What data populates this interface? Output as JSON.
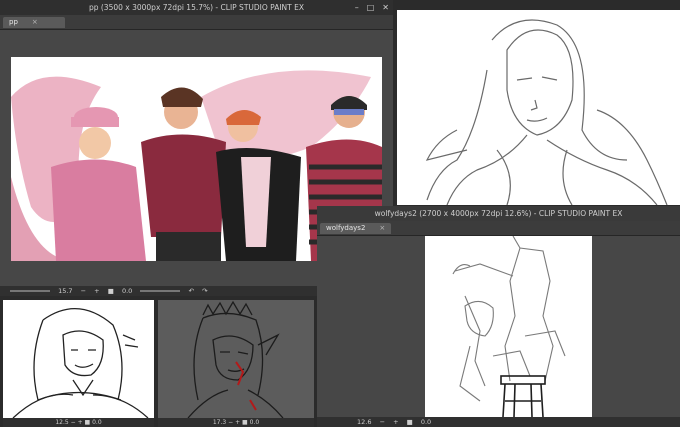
{
  "main_window": {
    "title": "pp (3500 x 3000px 72dpi 15.7%) - CLIP STUDIO PAINT EX",
    "tab_label": "pp",
    "tab_close": "×",
    "controls": {
      "minimize": "–",
      "maximize": "□",
      "close": "✕"
    },
    "status": {
      "zoom": "15.7",
      "angle": "0.0"
    }
  },
  "wolfy_window": {
    "title": "wolfydays2 (2700 x 4000px 72dpi 12.6%) - CLIP STUDIO PAINT EX",
    "tab_label": "wolfydays2",
    "tab_close": "×",
    "status": {
      "zoom": "12.6",
      "angle": "0.0"
    }
  },
  "small_window_1": {
    "status": {
      "zoom": "12.5",
      "angle": "0.0"
    }
  },
  "small_window_2": {
    "status": {
      "zoom": "17.3",
      "angle": "0.0"
    }
  },
  "status_icons": {
    "minus": "−",
    "plus": "+",
    "fit": "■",
    "rotate_left": "↶",
    "rotate_right": "↷"
  },
  "colors": {
    "app_bg": "#2b2b2b",
    "panel_bg": "#474747",
    "pink_wing": "#e8a5b8",
    "maroon": "#7a2335",
    "sketch_line": "#6a6a6a"
  }
}
